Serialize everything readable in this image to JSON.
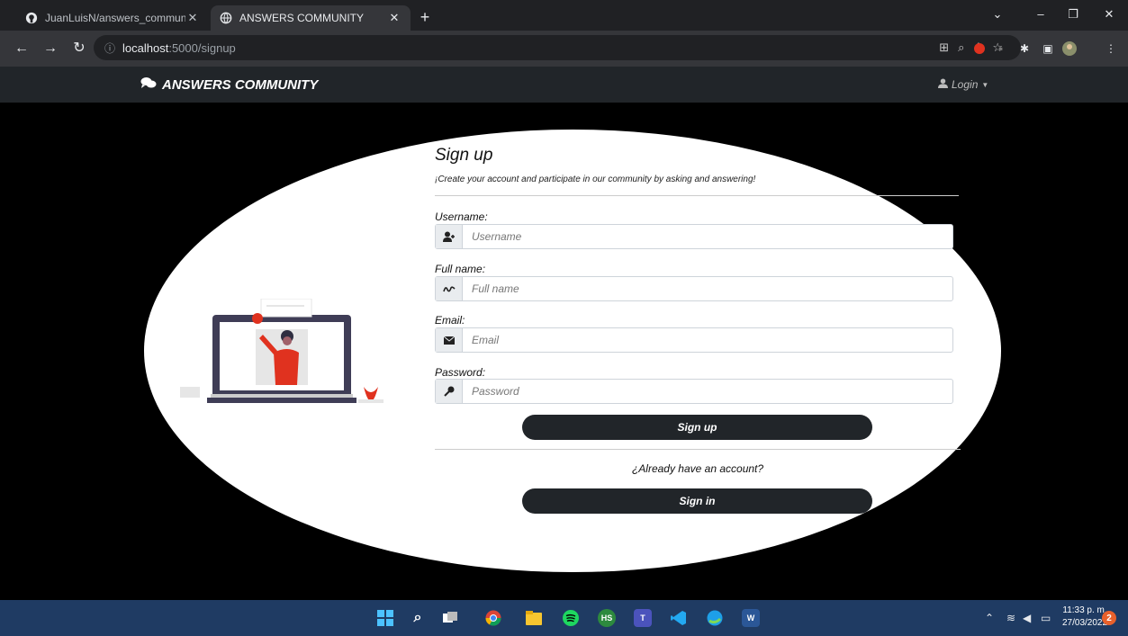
{
  "browser": {
    "tabs": [
      {
        "title": "JuanLuisN/answers_community",
        "icon": "github-icon",
        "active": false
      },
      {
        "title": "ANSWERS COMMUNITY",
        "icon": "globe-icon",
        "active": true
      }
    ],
    "url_host": "localhost",
    "url_path": ":5000/signup"
  },
  "navbar": {
    "brand": "ANSWERS COMMUNITY",
    "login_label": "Login"
  },
  "signup": {
    "title": "Sign up",
    "subtitle": "¡Create your account and participate in our community by asking and answering!",
    "fields": [
      {
        "label": "Username:",
        "placeholder": "Username",
        "icon": "user-add-icon"
      },
      {
        "label": "Full name:",
        "placeholder": "Full name",
        "icon": "signature-icon"
      },
      {
        "label": "Email:",
        "placeholder": "Email",
        "icon": "envelope-icon"
      },
      {
        "label": "Password:",
        "placeholder": "Password",
        "icon": "key-icon"
      }
    ],
    "submit_label": "Sign up",
    "already_text": "¿Already have an account?",
    "signin_label": "Sign in"
  },
  "taskbar": {
    "time": "11:33 p. m.",
    "date": "27/03/2022",
    "notifications": "2"
  },
  "colors": {
    "navbar": "#212529",
    "button": "#212529",
    "accent_red": "#e0321f",
    "taskbar": "#1f3b63"
  }
}
